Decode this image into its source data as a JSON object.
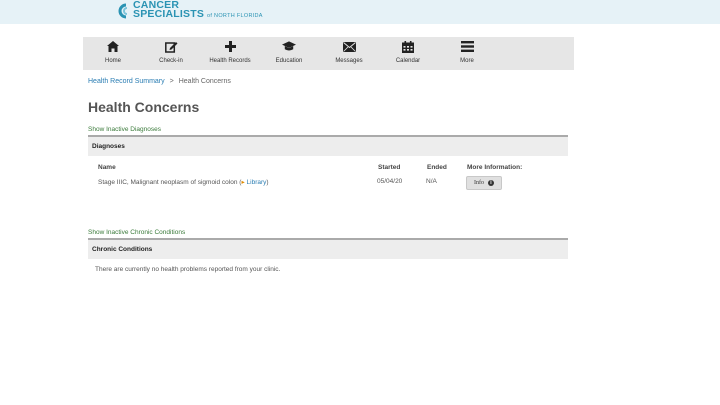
{
  "header": {
    "logo_line1": "CANCER",
    "logo_line2": "SPECIALISTS",
    "logo_sub": "of NORTH FLORIDA",
    "brand_color": "#2a93b3"
  },
  "nav": {
    "items": [
      {
        "label": "Home",
        "icon": "home-icon"
      },
      {
        "label": "Check-in",
        "icon": "edit-icon"
      },
      {
        "label": "Health Records",
        "icon": "plus-icon"
      },
      {
        "label": "Education",
        "icon": "graduation-cap-icon"
      },
      {
        "label": "Messages",
        "icon": "envelope-icon"
      },
      {
        "label": "Calendar",
        "icon": "calendar-icon"
      },
      {
        "label": "More",
        "icon": "menu-icon"
      }
    ]
  },
  "breadcrumb": {
    "parent": "Health Record Summary",
    "separator": ">",
    "current": "Health Concerns"
  },
  "page_title": "Health Concerns",
  "diagnoses": {
    "show_inactive_link": "Show Inactive Diagnoses",
    "section_title": "Diagnoses",
    "columns": {
      "name": "Name",
      "started": "Started",
      "ended": "Ended",
      "more_info": "More Information:"
    },
    "rows": [
      {
        "name": "Stage IIIC, Malignant neoplasm of sigmoid colon",
        "library_open": "(",
        "library_arrow": "▸",
        "library_label": "Library",
        "library_close": ")",
        "started": "05/04/20",
        "ended": "N/A",
        "info_button": "Info",
        "info_icon": "i"
      }
    ]
  },
  "chronic": {
    "show_inactive_link": "Show Inactive Chronic Conditions",
    "section_title": "Chronic Conditions",
    "empty_message": "There are currently no health problems reported from your clinic."
  }
}
